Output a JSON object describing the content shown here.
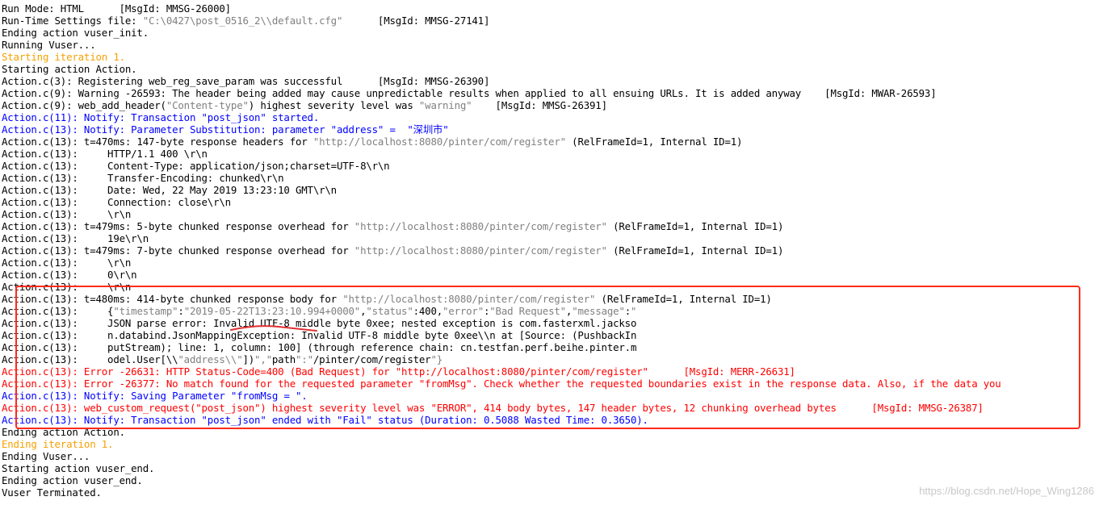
{
  "log": {
    "lines": [
      {
        "text": "Run Mode: HTML      [MsgId: MMSG-26000]",
        "style": "normal"
      },
      {
        "text": "Run-Time Settings file: \"C:\\0427\\post_0516_2\\\\default.cfg\"      [MsgId: MMSG-27141]",
        "style": "normal"
      },
      {
        "text": "Ending action vuser_init.",
        "style": "normal"
      },
      {
        "text": "Running Vuser...",
        "style": "normal"
      },
      {
        "text": "Starting iteration 1.",
        "style": "iter"
      },
      {
        "text": "Starting action Action.",
        "style": "normal"
      },
      {
        "text": "Action.c(3): Registering web_reg_save_param was successful      [MsgId: MMSG-26390]",
        "style": "normal"
      },
      {
        "text": "Action.c(9): Warning -26593: The header being added may cause unpredictable results when applied to all ensuing URLs. It is added anyway    [MsgId: MWAR-26593]",
        "style": "normal"
      },
      {
        "text": "Action.c(9): web_add_header(\"Content-type\") highest severity level was \"warning\"    [MsgId: MMSG-26391]",
        "style": "normal"
      },
      {
        "text": "Action.c(11): Notify: Transaction \"post_json\" started.",
        "style": "notify"
      },
      {
        "text": "Action.c(13): Notify: Parameter Substitution: parameter \"address\" =  \"深圳市\"",
        "style": "notify"
      },
      {
        "text": "Action.c(13): t=470ms: 147-byte response headers for \"http://localhost:8080/pinter/com/register\" (RelFrameId=1, Internal ID=1)",
        "style": "normal"
      },
      {
        "text": "Action.c(13):     HTTP/1.1 400 \\r\\n",
        "style": "normal"
      },
      {
        "text": "Action.c(13):     Content-Type: application/json;charset=UTF-8\\r\\n",
        "style": "normal"
      },
      {
        "text": "Action.c(13):     Transfer-Encoding: chunked\\r\\n",
        "style": "normal"
      },
      {
        "text": "Action.c(13):     Date: Wed, 22 May 2019 13:23:10 GMT\\r\\n",
        "style": "normal"
      },
      {
        "text": "Action.c(13):     Connection: close\\r\\n",
        "style": "normal"
      },
      {
        "text": "Action.c(13):     \\r\\n",
        "style": "normal"
      },
      {
        "text": "Action.c(13): t=479ms: 5-byte chunked response overhead for \"http://localhost:8080/pinter/com/register\" (RelFrameId=1, Internal ID=1)",
        "style": "normal"
      },
      {
        "text": "Action.c(13):     19e\\r\\n",
        "style": "normal"
      },
      {
        "text": "Action.c(13): t=479ms: 7-byte chunked response overhead for \"http://localhost:8080/pinter/com/register\" (RelFrameId=1, Internal ID=1)",
        "style": "normal"
      },
      {
        "text": "Action.c(13):     \\r\\n",
        "style": "normal"
      },
      {
        "text": "Action.c(13):     0\\r\\n",
        "style": "normal"
      },
      {
        "text": "Action.c(13):     \\r\\n",
        "style": "normal"
      },
      {
        "text": "Action.c(13): t=480ms: 414-byte chunked response body for \"http://localhost:8080/pinter/com/register\" (RelFrameId=1, Internal ID=1)",
        "style": "normal"
      },
      {
        "text": "Action.c(13):     {\"timestamp\":\"2019-05-22T13:23:10.994+0000\",\"status\":400,\"error\":\"Bad Request\",\"message\":\"",
        "style": "normal"
      },
      {
        "text": "Action.c(13):     JSON parse error: Invalid UTF-8 middle byte 0xee; nested exception is com.fasterxml.jackso",
        "style": "normal"
      },
      {
        "text": "Action.c(13):     n.databind.JsonMappingException: Invalid UTF-8 middle byte 0xee\\\\n at [Source: (PushbackIn",
        "style": "normal"
      },
      {
        "text": "Action.c(13):     putStream); line: 1, column: 100] (through reference chain: cn.testfan.perf.beihe.pinter.m",
        "style": "normal"
      },
      {
        "text": "Action.c(13):     odel.User[\\\\\"address\\\\\"])\",\"path\":\"/pinter/com/register\"}",
        "style": "normal"
      },
      {
        "text": "Action.c(13): Error -26631: HTTP Status-Code=400 (Bad Request) for \"http://localhost:8080/pinter/com/register\"      [MsgId: MERR-26631]",
        "style": "error"
      },
      {
        "text": "Action.c(13): Error -26377: No match found for the requested parameter \"fromMsg\". Check whether the requested boundaries exist in the response data. Also, if the data you",
        "style": "error"
      },
      {
        "text": "Action.c(13): Notify: Saving Parameter \"fromMsg = \".",
        "style": "notify"
      },
      {
        "text": "Action.c(13): web_custom_request(\"post_json\") highest severity level was \"ERROR\", 414 body bytes, 147 header bytes, 12 chunking overhead bytes      [MsgId: MMSG-26387]",
        "style": "error"
      },
      {
        "text": "Action.c(13): Notify: Transaction \"post_json\" ended with \"Fail\" status (Duration: 0.5088 Wasted Time: 0.3650).",
        "style": "notify"
      },
      {
        "text": "Ending action Action.",
        "style": "normal"
      },
      {
        "text": "Ending iteration 1.",
        "style": "iter"
      },
      {
        "text": "Ending Vuser...",
        "style": "normal"
      },
      {
        "text": "Starting action vuser_end.",
        "style": "normal"
      },
      {
        "text": "Ending action vuser_end.",
        "style": "normal"
      },
      {
        "text": "Vuser Terminated.",
        "style": "normal"
      }
    ]
  },
  "watermark": "https://blog.csdn.net/Hope_Wing1286",
  "colors": {
    "normal_text": "#000000",
    "iteration_text": "#f5a000",
    "notify_text": "#0000ff",
    "error_text": "#ff0000",
    "quoted_text": "#808080",
    "highlight_box": "#ff2a1a",
    "underline_mark": "#e03030"
  }
}
